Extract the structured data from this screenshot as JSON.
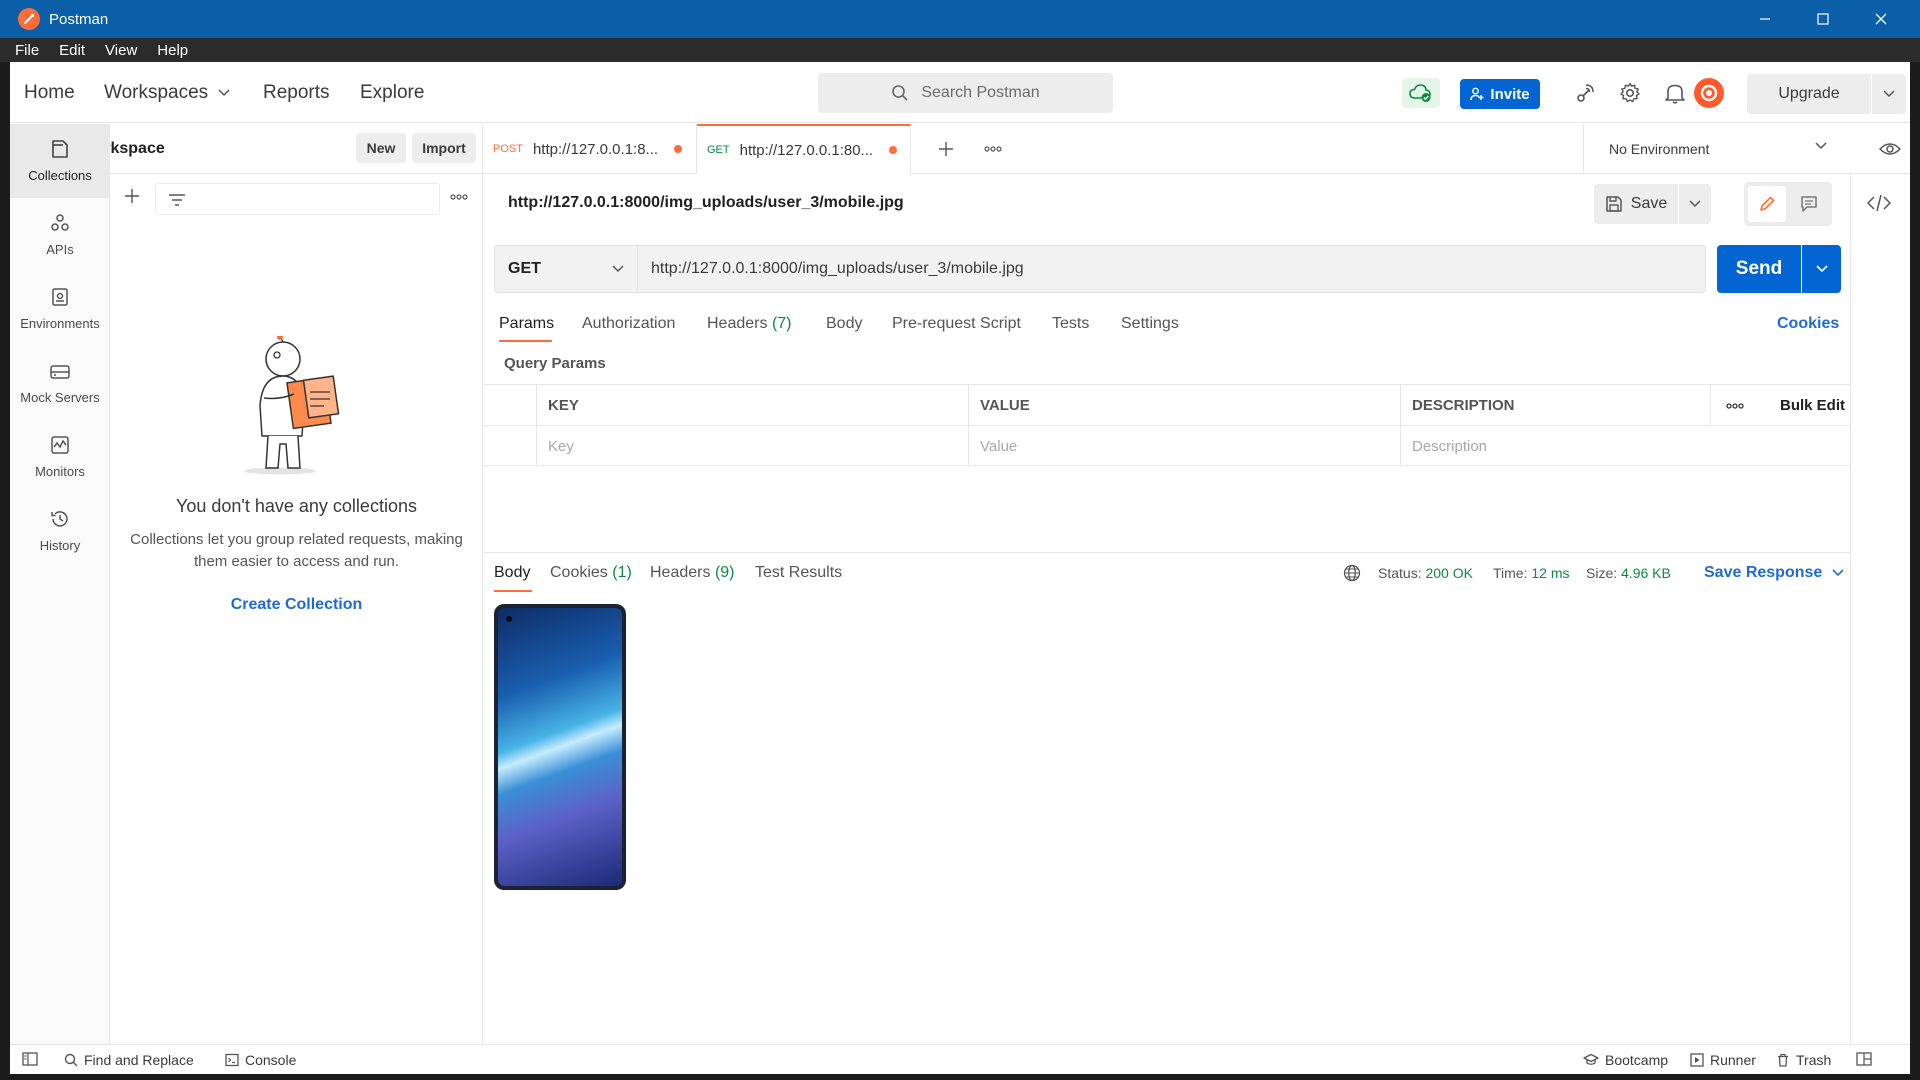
{
  "window": {
    "title": "Postman"
  },
  "menu": [
    "File",
    "Edit",
    "View",
    "Help"
  ],
  "header": {
    "nav": {
      "home": "Home",
      "workspaces": "Workspaces",
      "reports": "Reports",
      "explore": "Explore"
    },
    "search_placeholder": "Search Postman",
    "invite": "Invite",
    "upgrade": "Upgrade"
  },
  "workspace": {
    "name": "My Workspace",
    "new": "New",
    "import": "Import"
  },
  "rail": [
    {
      "label": "Collections",
      "icon": "collections-icon"
    },
    {
      "label": "APIs",
      "icon": "apis-icon"
    },
    {
      "label": "Environments",
      "icon": "environments-icon"
    },
    {
      "label": "Mock Servers",
      "icon": "mock-servers-icon"
    },
    {
      "label": "Monitors",
      "icon": "monitors-icon"
    },
    {
      "label": "History",
      "icon": "history-icon"
    }
  ],
  "collections_panel": {
    "empty_title": "You don't have any collections",
    "empty_text": "Collections let you group related requests, making them easier to access and run.",
    "create": "Create Collection"
  },
  "tabs": [
    {
      "method": "POST",
      "url": "http://127.0.0.1:8...",
      "method_color": "#ff6c37"
    },
    {
      "method": "GET",
      "url": "http://127.0.0.1:80...",
      "method_color": "#0c8a42"
    }
  ],
  "environment": "No Environment",
  "request": {
    "title": "http://127.0.0.1:8000/img_uploads/user_3/mobile.jpg",
    "save": "Save",
    "method": "GET",
    "url": "http://127.0.0.1:8000/img_uploads/user_3/mobile.jpg",
    "send": "Send",
    "tabs": {
      "params": "Params",
      "authorization": "Authorization",
      "headers": "Headers",
      "headers_count": "(7)",
      "body": "Body",
      "prerequest": "Pre-request Script",
      "tests": "Tests",
      "settings": "Settings"
    },
    "cookies": "Cookies",
    "query_params_label": "Query Params",
    "table": {
      "headers": {
        "key": "KEY",
        "value": "VALUE",
        "description": "DESCRIPTION",
        "bulk_edit": "Bulk Edit"
      },
      "placeholders": {
        "key": "Key",
        "value": "Value",
        "description": "Description"
      }
    }
  },
  "response": {
    "tabs": {
      "body": "Body",
      "cookies": "Cookies",
      "cookies_count": "(1)",
      "headers": "Headers",
      "headers_count": "(9)",
      "test_results": "Test Results"
    },
    "status_label": "Status:",
    "status": "200 OK",
    "time_label": "Time:",
    "time": "12 ms",
    "size_label": "Size:",
    "size": "4.96 KB",
    "save_response": "Save Response"
  },
  "statusbar": {
    "find_replace": "Find and Replace",
    "console": "Console",
    "bootcamp": "Bootcamp",
    "runner": "Runner",
    "trash": "Trash"
  },
  "colors": {
    "accent": "#ff6c37",
    "primary": "#0265d2",
    "success": "#0c8a42",
    "titlebar": "#0b5ea8"
  }
}
